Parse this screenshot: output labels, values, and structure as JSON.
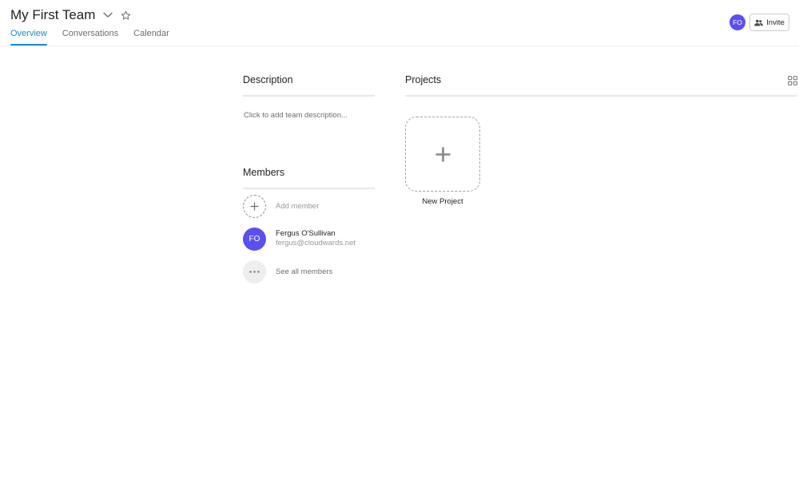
{
  "header": {
    "team_title": "My First Team",
    "tabs": [
      {
        "label": "Overview",
        "active": true
      },
      {
        "label": "Conversations",
        "active": false
      },
      {
        "label": "Calendar",
        "active": false
      }
    ],
    "user_avatar_initials": "FO",
    "invite_label": "Invite"
  },
  "description": {
    "title": "Description",
    "placeholder": "Click to add team description..."
  },
  "members": {
    "title": "Members",
    "add_label": "Add member",
    "list": [
      {
        "initials": "FO",
        "name": "Fergus O'Sullivan",
        "email": "fergus@cloudwards.net"
      }
    ],
    "see_all_label": "See all members"
  },
  "projects": {
    "title": "Projects",
    "new_project_label": "New Project"
  },
  "colors": {
    "accent": "#1f8ad2",
    "avatar": "#5b4ff0"
  },
  "icons": [
    "chevron-down-icon",
    "star-icon",
    "people-icon",
    "plus-icon",
    "ellipsis-icon",
    "grid-view-icon"
  ]
}
